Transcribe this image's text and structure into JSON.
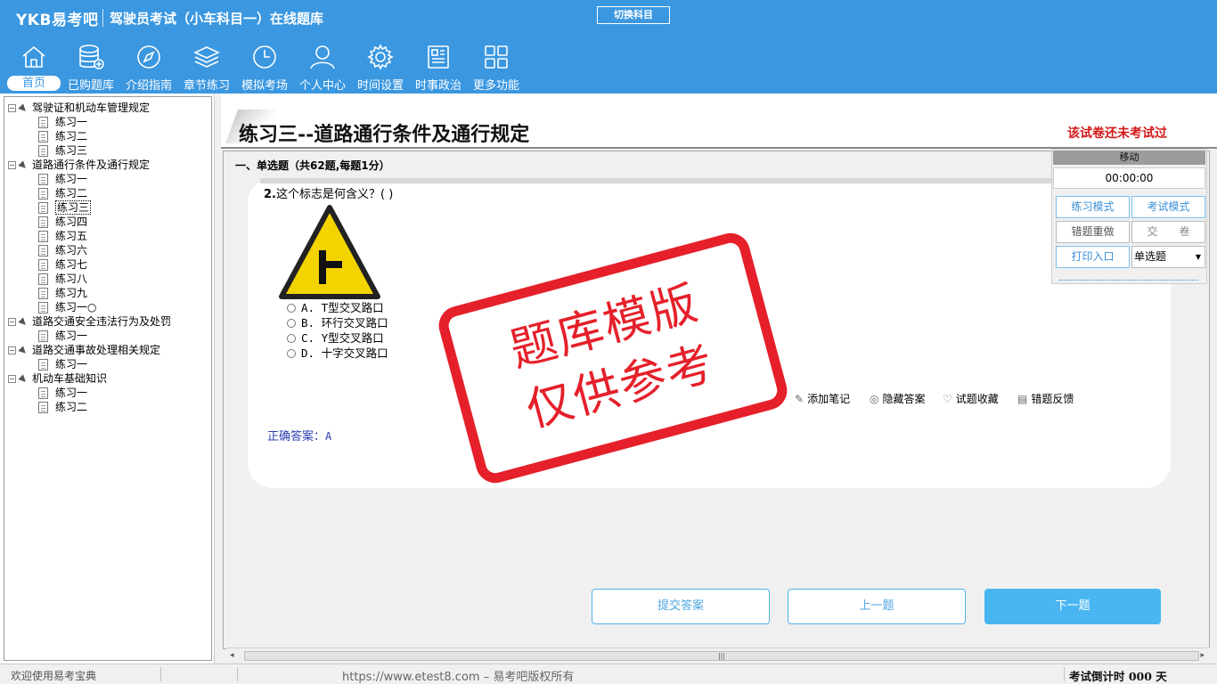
{
  "header": {
    "logo": "YKB易考吧",
    "title": "驾驶员考试（小车科目一）在线题库",
    "switch_subject": "切换科目"
  },
  "nav": [
    {
      "label": "首页",
      "icon": "home-icon"
    },
    {
      "label": "已购题库",
      "icon": "database-icon"
    },
    {
      "label": "介绍指南",
      "icon": "compass-icon"
    },
    {
      "label": "章节练习",
      "icon": "layers-icon"
    },
    {
      "label": "模拟考场",
      "icon": "clock-icon"
    },
    {
      "label": "个人中心",
      "icon": "user-icon"
    },
    {
      "label": "时间设置",
      "icon": "gear-icon"
    },
    {
      "label": "时事政治",
      "icon": "news-icon"
    },
    {
      "label": "更多功能",
      "icon": "grid-icon"
    }
  ],
  "tree": {
    "chapters": [
      {
        "label": "驾驶证和机动车管理规定",
        "items": [
          "练习一",
          "练习二",
          "练习三"
        ]
      },
      {
        "label": "道路通行条件及通行规定",
        "items": [
          "练习一",
          "练习二",
          "练习三",
          "练习四",
          "练习五",
          "练习六",
          "练习七",
          "练习八",
          "练习九",
          "练习一○"
        ]
      },
      {
        "label": "道路交通安全违法行为及处罚",
        "items": [
          "练习一"
        ]
      },
      {
        "label": "道路交通事故处理相关规定",
        "items": [
          "练习一"
        ]
      },
      {
        "label": "机动车基础知识",
        "items": [
          "练习一",
          "练习二"
        ]
      }
    ]
  },
  "main": {
    "title": "练习三--道路通行条件及通行规定",
    "exam_status": "该试卷还未考试过",
    "section_heading": "一、单选题（共62题,每题1分）",
    "question": {
      "number": "2.",
      "text": "这个标志是何含义？( )",
      "options": [
        "A. T型交叉路口",
        "B. 环行交叉路口",
        "C. Y型交叉路口",
        "D. 十字交叉路口"
      ],
      "actions": [
        "添加笔记",
        "隐藏答案",
        "试题收藏",
        "错题反馈"
      ],
      "answer_label": "正确答案：",
      "answer_value": "A"
    },
    "watermark": {
      "line1": "题库模版",
      "line2": "仅供参考"
    },
    "buttons": {
      "submit": "提交答案",
      "prev": "上一题",
      "next": "下一题"
    }
  },
  "float_panel": {
    "move": "移动",
    "timer": "00:00:00",
    "practice_mode": "练习模式",
    "exam_mode": "考试模式",
    "redo_wrong": "错题重做",
    "hand_in": "交　　卷",
    "print": "打印入口",
    "question_type": "单选题"
  },
  "status_bar": {
    "welcome": "欢迎使用易考宝典",
    "copyright": "https://www.etest8.com – 易考吧版权所有",
    "countdown": "考试倒计时 000 天"
  },
  "colors": {
    "header_bg": "#3a97e0",
    "accent": "#49b6f1",
    "warning_red": "#d21818",
    "stamp_red": "#e5202a",
    "sign_yellow": "#f3d400"
  }
}
